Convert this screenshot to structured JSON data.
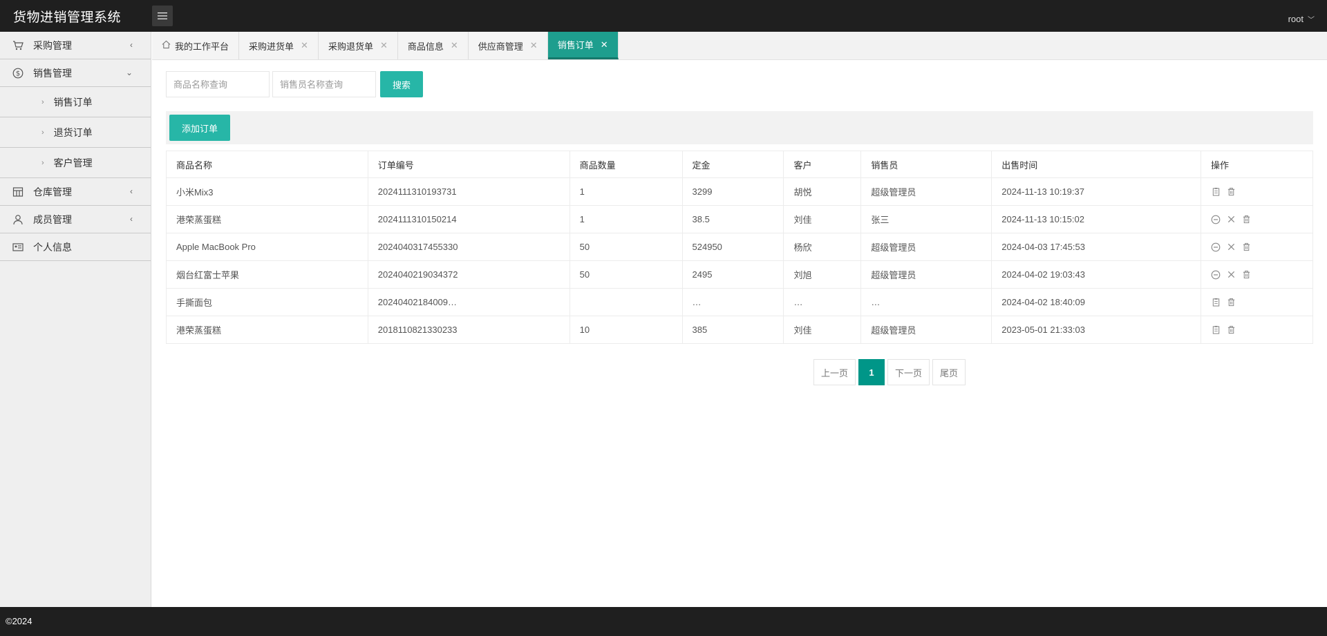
{
  "header": {
    "title": "货物进销管理系统",
    "user": "root"
  },
  "sidebar": {
    "items": [
      {
        "label": "采购管理",
        "icon": "cart-icon",
        "arrow": "‹"
      },
      {
        "label": "销售管理",
        "icon": "dollar-icon",
        "arrow": "⌄"
      },
      {
        "label": "仓库管理",
        "icon": "warehouse-icon",
        "arrow": "‹"
      },
      {
        "label": "成员管理",
        "icon": "user-icon",
        "arrow": "‹"
      },
      {
        "label": "个人信息",
        "icon": "id-card-icon",
        "arrow": ""
      }
    ],
    "sales_sub": [
      {
        "label": "销售订单"
      },
      {
        "label": "退货订单"
      },
      {
        "label": "客户管理"
      }
    ]
  },
  "tabs": [
    {
      "label": "我的工作平台",
      "closable": false,
      "active": false
    },
    {
      "label": "采购进货单",
      "closable": true,
      "active": false
    },
    {
      "label": "采购退货单",
      "closable": true,
      "active": false
    },
    {
      "label": "商品信息",
      "closable": true,
      "active": false
    },
    {
      "label": "供应商管理",
      "closable": true,
      "active": false
    },
    {
      "label": "销售订单",
      "closable": true,
      "active": true
    }
  ],
  "search": {
    "product_placeholder": "商品名称查询",
    "seller_placeholder": "销售员名称查询",
    "button": "搜索"
  },
  "toolbar": {
    "add_label": "添加订单"
  },
  "table": {
    "headers": [
      "商品名称",
      "订单编号",
      "商品数量",
      "定金",
      "客户",
      "销售员",
      "出售时间",
      "操作"
    ],
    "rows": [
      {
        "cells": [
          "小米Mix3",
          "2024111310193731",
          "1",
          "3299",
          "胡悦",
          "超级管理员",
          "2024-11-13 10:19:37"
        ],
        "ops": [
          "clipboard-icon",
          "trash-icon"
        ]
      },
      {
        "cells": [
          "港荣蒸蛋糕",
          "2024111310150214",
          "1",
          "38.5",
          "刘佳",
          "张三",
          "2024-11-13 10:15:02"
        ],
        "ops": [
          "minus-circle-icon",
          "close-icon",
          "trash-icon"
        ]
      },
      {
        "cells": [
          "Apple MacBook Pro",
          "2024040317455330",
          "50",
          "524950",
          "杨欣",
          "超级管理员",
          "2024-04-03 17:45:53"
        ],
        "ops": [
          "minus-circle-icon",
          "close-icon",
          "trash-icon"
        ]
      },
      {
        "cells": [
          "烟台红富士苹果",
          "2024040219034372",
          "50",
          "2495",
          "刘旭",
          "超级管理员",
          "2024-04-02 19:03:43"
        ],
        "ops": [
          "minus-circle-icon",
          "close-icon",
          "trash-icon"
        ]
      },
      {
        "cells": [
          "手撕面包",
          "20240402184009…",
          "",
          "…",
          "…",
          "…",
          "2024-04-02 18:40:09"
        ],
        "ops": [
          "clipboard-icon",
          "trash-icon"
        ]
      },
      {
        "cells": [
          "港荣蒸蛋糕",
          "2018110821330233",
          "10",
          "385",
          "刘佳",
          "超级管理员",
          "2023-05-01 21:33:03"
        ],
        "ops": [
          "clipboard-icon",
          "trash-icon"
        ]
      }
    ]
  },
  "pager": {
    "prev": "上一页",
    "current": "1",
    "next": "下一页",
    "last": "尾页"
  },
  "footer": {
    "copyright": "©2024"
  }
}
